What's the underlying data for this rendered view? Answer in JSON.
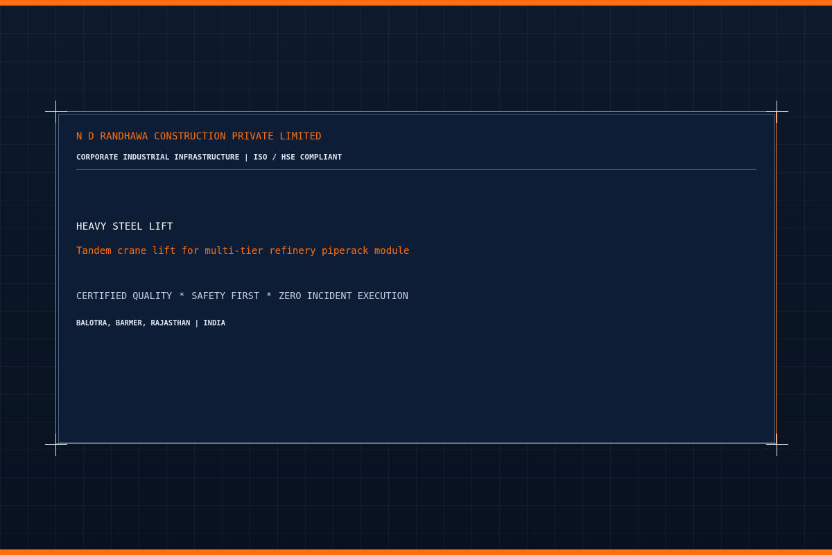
{
  "header": {
    "company": "N D RANDHAWA CONSTRUCTION PRIVATE LIMITED",
    "tagline": "CORPORATE INDUSTRIAL INFRASTRUCTURE | ISO / HSE COMPLIANT"
  },
  "main": {
    "title": "HEAVY STEEL LIFT",
    "subtitle": "Tandem crane lift for multi-tier refinery piperack module",
    "values": [
      "CERTIFIED QUALITY",
      "SAFETY FIRST",
      "ZERO INCIDENT EXECUTION"
    ],
    "separator": "*",
    "location": "BALOTRA, BARMER, RAJASTHAN | INDIA"
  },
  "colors": {
    "accent": "#ff6f0f",
    "background": "#0b1626",
    "panel": "#0e1e37",
    "text": "#dbe3ee"
  }
}
